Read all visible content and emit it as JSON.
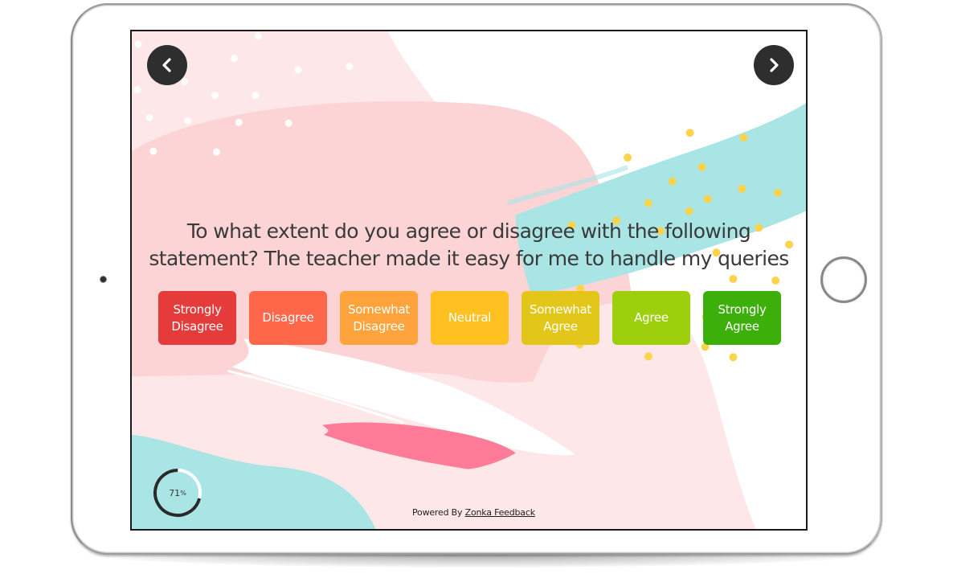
{
  "survey": {
    "question_line1": "To what extent do you agree or disagree with the following",
    "question_line2": "statement? The teacher made it easy for me to handle my queries",
    "options": [
      {
        "label_line1": "Strongly",
        "label_line2": "Disagree",
        "color": "#e53b3b"
      },
      {
        "label_line1": "Disagree",
        "label_line2": "",
        "color": "#ff674b"
      },
      {
        "label_line1": "Somewhat",
        "label_line2": "Disagree",
        "color": "#ffa43d"
      },
      {
        "label_line1": "Neutral",
        "label_line2": "",
        "color": "#ffc021"
      },
      {
        "label_line1": "Somewhat",
        "label_line2": "Agree",
        "color": "#e2c61a"
      },
      {
        "label_line1": "Agree",
        "label_line2": "",
        "color": "#9ecf0c"
      },
      {
        "label_line1": "Strongly",
        "label_line2": "Agree",
        "color": "#3caf0a"
      }
    ]
  },
  "navigation": {
    "prev_icon": "chevron-left-icon",
    "next_icon": "chevron-right-icon"
  },
  "progress": {
    "value": 71,
    "number": "71",
    "unit": "%"
  },
  "footer": {
    "powered_by": "Powered By",
    "brand_link": "Zonka Feedback"
  },
  "colors": {
    "background_pink": "#fde7e8",
    "blob_pink": "#fcd4d6",
    "teal": "#a9e5e4",
    "brush_pink": "#ff7b98",
    "dot_yellow": "#fcd34d",
    "nav_button": "#2e2e2e"
  }
}
